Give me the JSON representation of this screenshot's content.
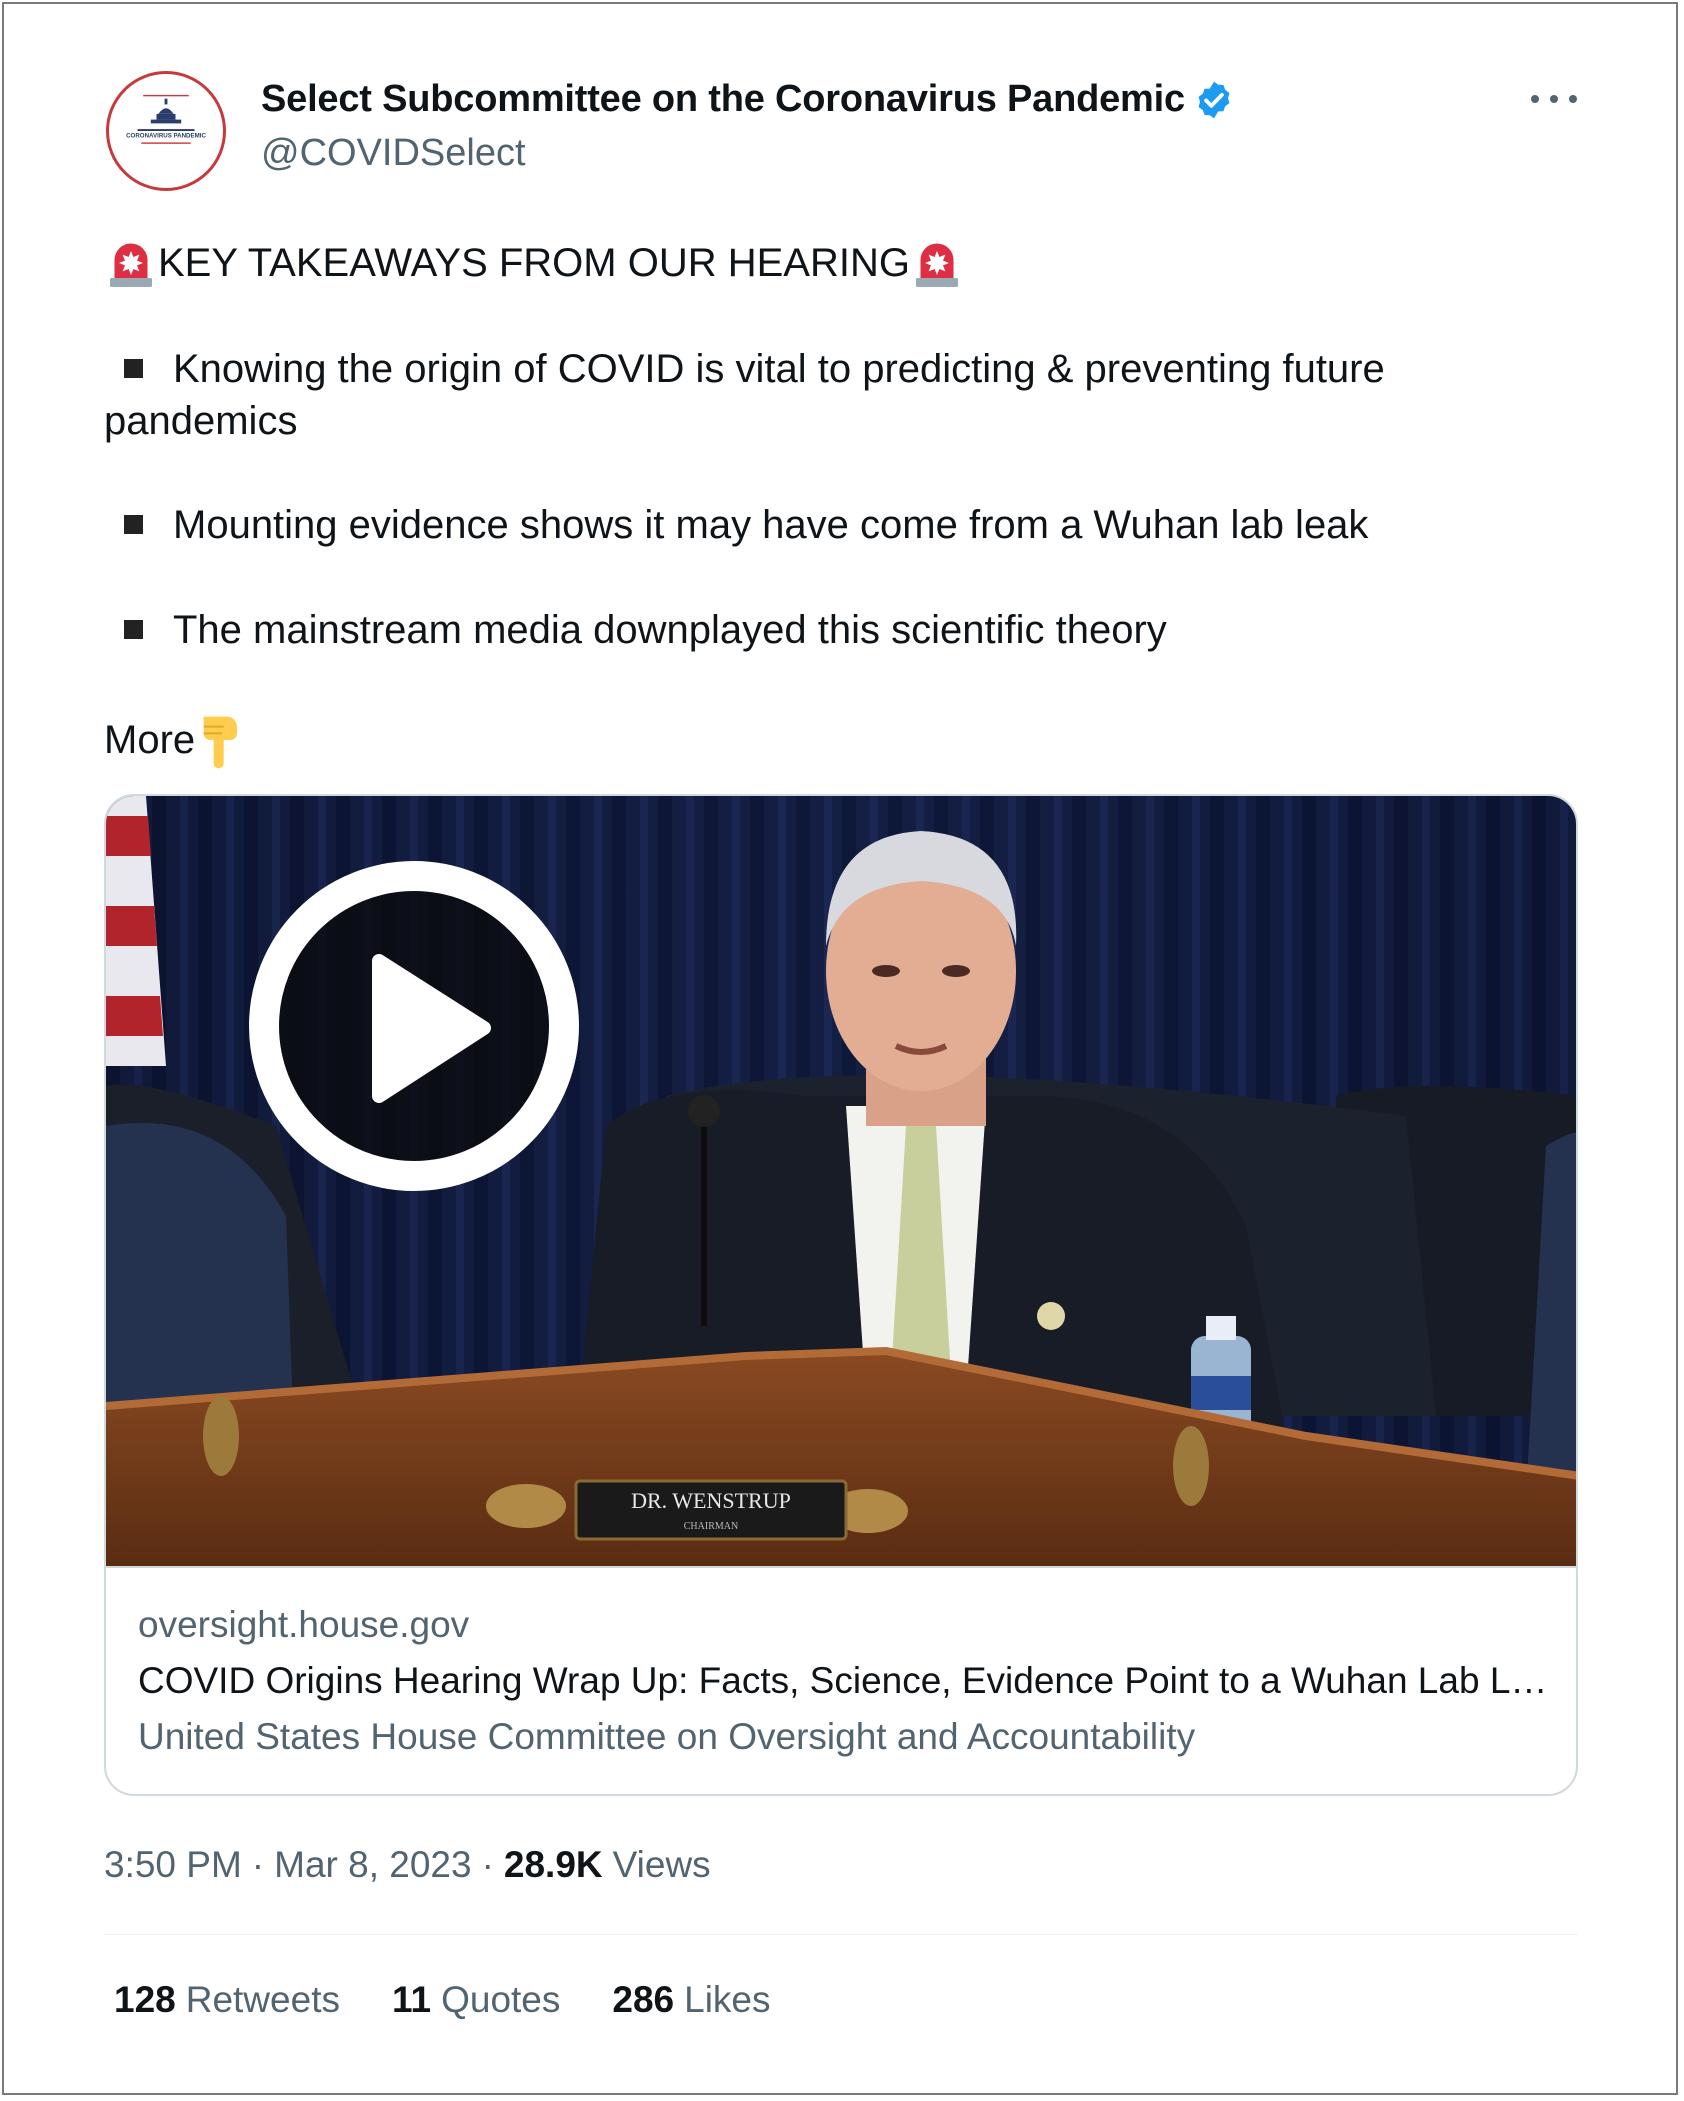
{
  "author": {
    "display_name": "Select Subcommittee on the Coronavirus Pandemic",
    "handle": "@COVIDSelect",
    "avatar_text": "CORONAVIRUS PANDEMIC",
    "verified_color": "#1d9bf0"
  },
  "tweet": {
    "headline": "KEY TAKEAWAYS FROM OUR HEARING",
    "headline_icon": "rotating-light-icon",
    "bullets": [
      "Knowing the origin of COVID is vital to predicting & preventing future pandemics",
      "Mounting evidence shows it may have come from a  Wuhan lab leak",
      "The mainstream media downplayed this scientific theory"
    ],
    "more_label": "More",
    "more_icon": "backhand-index-pointing-down-icon"
  },
  "card": {
    "nameplate": "DR. WENSTRUP",
    "nameplate_sub": "CHAIRMAN",
    "domain": "oversight.house.gov",
    "title": "COVID Origins Hearing Wrap Up: Facts, Science, Evidence Point to a Wuhan Lab Leak",
    "description": "United States House Committee on Oversight and Accountability"
  },
  "meta": {
    "time": "3:50 PM",
    "separator": "·",
    "date": "Mar 8, 2023",
    "views_count": "28.9K",
    "views_label": "Views"
  },
  "stats": [
    {
      "count": "128",
      "label": "Retweets"
    },
    {
      "count": "11",
      "label": "Quotes"
    },
    {
      "count": "286",
      "label": "Likes"
    }
  ]
}
